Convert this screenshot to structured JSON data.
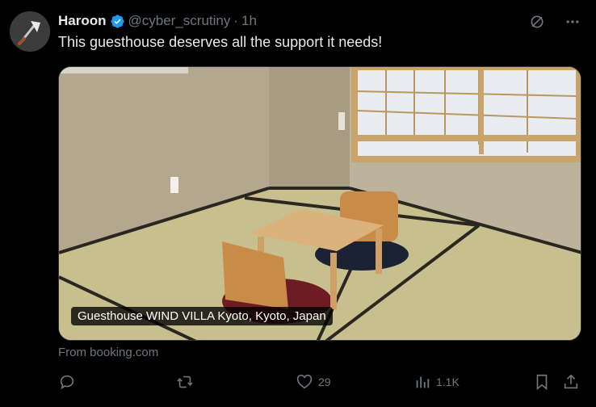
{
  "post": {
    "author_name": "Haroon",
    "author_handle": "@cyber_scrutiny",
    "separator": "·",
    "time": "1h",
    "text": "This guesthouse deserves all the support it needs!",
    "media_caption": "Guesthouse WIND VILLA Kyoto, Kyoto, Japan",
    "source": "From booking.com"
  },
  "actions": {
    "likes": "29",
    "views": "1.1K"
  },
  "colors": {
    "background": "#000000",
    "text": "#e7e9ea",
    "muted": "#71767b",
    "verified": "#1d9bf0"
  },
  "icons": {
    "verified": "verified-badge-icon",
    "grok": "grok-icon",
    "more": "more-icon",
    "reply": "reply-icon",
    "retweet": "retweet-icon",
    "like": "like-icon",
    "views": "views-icon",
    "bookmark": "bookmark-icon",
    "share": "share-icon"
  }
}
